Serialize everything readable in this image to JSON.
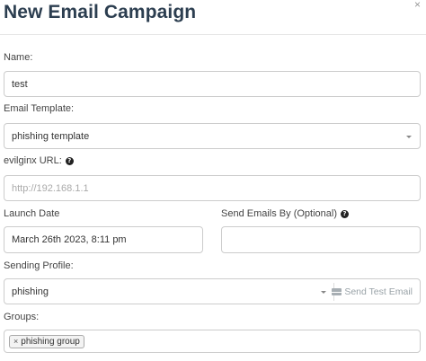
{
  "header": {
    "title": "New Email Campaign",
    "close_glyph": "×"
  },
  "form": {
    "name": {
      "label": "Name:",
      "value": "test"
    },
    "template": {
      "label": "Email Template:",
      "value": "phishing template"
    },
    "url": {
      "label": "evilginx URL:",
      "placeholder": "http://192.168.1.1"
    },
    "launch_date": {
      "label": "Launch Date",
      "value": "March 26th 2023, 8:11 pm"
    },
    "send_by": {
      "label": "Send Emails By (Optional)",
      "value": ""
    },
    "sending_profile": {
      "label": "Sending Profile:",
      "value": "phishing",
      "test_email_label": "Send Test Email"
    },
    "groups": {
      "label": "Groups:",
      "tags": [
        "phishing group"
      ],
      "tag_remove_glyph": "×"
    }
  },
  "icons": {
    "help": "question-circle-icon",
    "envelope": "envelope-icon",
    "caret": "chevron-down-icon"
  }
}
